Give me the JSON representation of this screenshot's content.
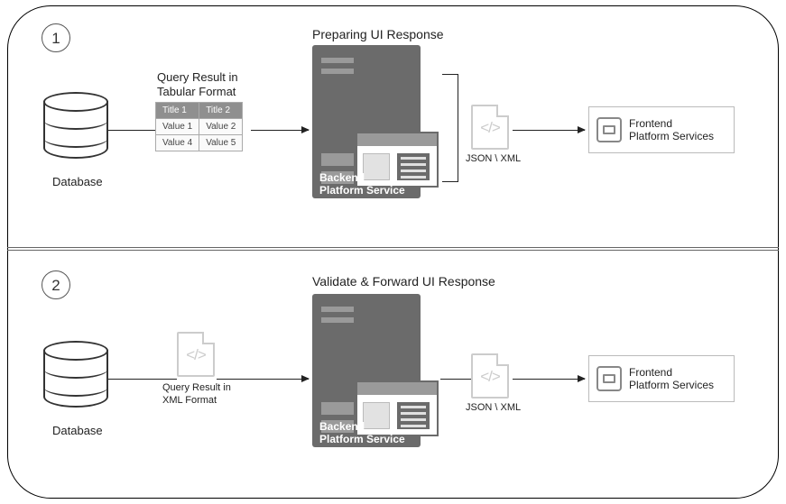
{
  "steps": {
    "one": {
      "num": "1",
      "title": "Preparing UI Response"
    },
    "two": {
      "num": "2",
      "title": "Validate & Forward UI Response"
    }
  },
  "database_label": "Database",
  "query_tabular_caption": "Query Result in\nTabular Format",
  "query_xml_caption": "Query Result in\nXML Format",
  "table": {
    "headers": [
      "Title 1",
      "Title 2"
    ],
    "rows": [
      [
        "Value 1",
        "Value 2"
      ],
      [
        "Value 4",
        "Value 5"
      ]
    ]
  },
  "backend_caption": "Backend\nPlatform Service",
  "json_xml_label": "JSON \\ XML",
  "frontend_caption": "Frontend\nPlatform Services",
  "code_glyph": "</>"
}
